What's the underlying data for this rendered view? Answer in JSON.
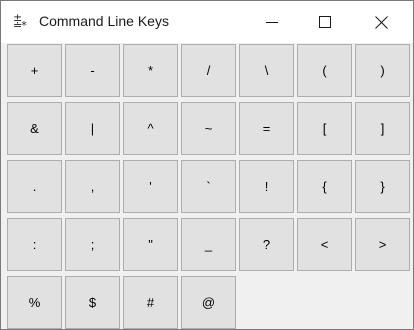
{
  "window": {
    "title": "Command Line Keys",
    "app_icon_lines": [
      "±",
      "≐*"
    ]
  },
  "keys": [
    [
      "+",
      "-",
      "*",
      "/",
      "\\",
      "(",
      ")"
    ],
    [
      "&",
      "|",
      "^",
      "~",
      "=",
      "[",
      "]"
    ],
    [
      ".",
      ",",
      "'",
      "`",
      "!",
      "{",
      "}"
    ],
    [
      ":",
      ";",
      "\"",
      "_",
      "?",
      "<",
      ">"
    ],
    [
      "%",
      "$",
      "#",
      "@"
    ]
  ],
  "colors": {
    "titlebar_bg": "#ffffff",
    "client_bg": "#f0f0f0",
    "key_bg": "#e1e1e1",
    "key_border": "#adadad"
  },
  "icons": {
    "minimize": "minimize-icon",
    "maximize": "maximize-icon",
    "close": "close-icon"
  }
}
